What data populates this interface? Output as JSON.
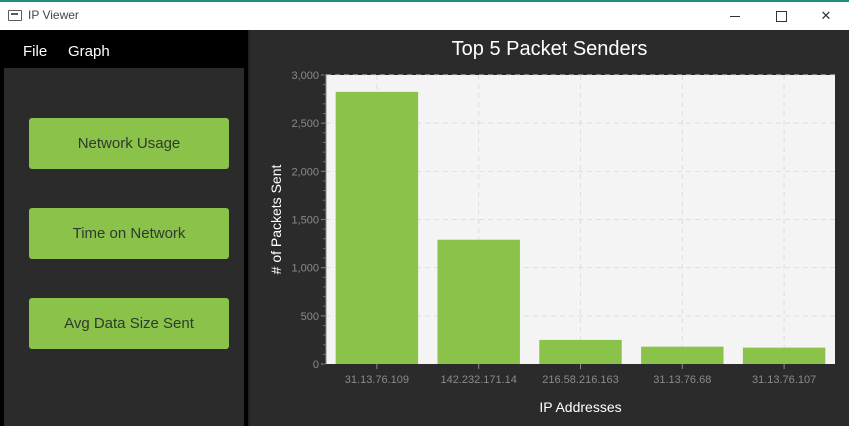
{
  "window": {
    "title": "IP Viewer",
    "controls": {
      "minimize": "—",
      "maximize": "☐",
      "close": "✕"
    }
  },
  "menu": {
    "items": [
      "File",
      "Graph"
    ]
  },
  "sidebar": {
    "buttons": [
      "Network Usage",
      "Time on Network",
      "Avg Data Size Sent"
    ]
  },
  "chart_data": {
    "type": "bar",
    "title": "Top 5 Packet Senders",
    "xlabel": "IP Addresses",
    "ylabel": "# of Packets Sent",
    "categories": [
      "31.13.76.109",
      "142.232.171.14",
      "216.58.216.163",
      "31.13.76.68",
      "31.13.76.107"
    ],
    "values": [
      2825,
      1290,
      250,
      180,
      170
    ],
    "ylim": [
      0,
      3000
    ],
    "yticks": [
      "0",
      "500",
      "1,000",
      "1,500",
      "2,000",
      "2,500",
      "3,000"
    ],
    "grid": true,
    "legend": "none"
  },
  "colors": {
    "bar": "#8bc34a",
    "plot_background": "#f4f4f4",
    "accent": "#8bc34a"
  }
}
